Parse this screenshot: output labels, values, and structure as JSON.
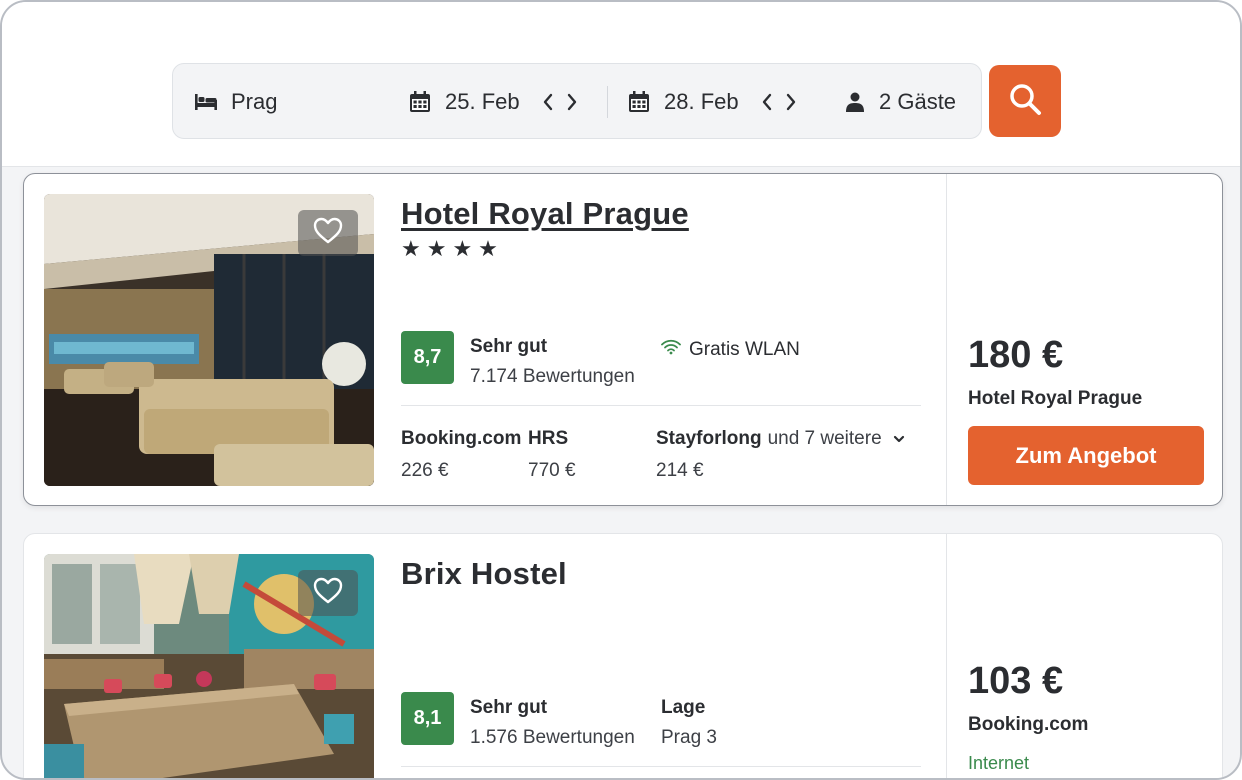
{
  "search": {
    "destination": "Prag",
    "checkin": "25. Feb",
    "checkout": "28. Feb",
    "guests": "2 Gäste",
    "accent_color": "#e4622f"
  },
  "hotels": [
    {
      "name": "Hotel Royal Prague",
      "stars": "★★★★",
      "rating": "8,7",
      "rating_label": "Sehr gut",
      "reviews": "7.174 Bewertungen",
      "amenity": "Gratis WLAN",
      "providers": [
        {
          "name": "Booking.com",
          "price": "226 €"
        },
        {
          "name": "HRS",
          "price": "770 €"
        },
        {
          "name": "Stayforlong",
          "more": "und 7 weitere",
          "price": "214 €"
        }
      ],
      "price": "180 €",
      "price_source": "Hotel Royal Prague",
      "cta": "Zum Angebot"
    },
    {
      "name": "Brix Hostel",
      "rating": "8,1",
      "rating_label": "Sehr gut",
      "reviews": "1.576 Bewertungen",
      "location_label": "Lage",
      "location": "Prag 3",
      "price": "103 €",
      "price_source": "Booking.com",
      "price_extra": "Internet"
    }
  ],
  "colors": {
    "rating_green": "#3a8a4c",
    "text_dark": "#2b2d31"
  }
}
